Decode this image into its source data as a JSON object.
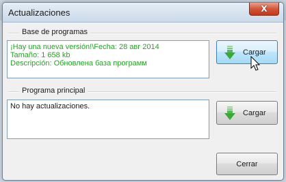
{
  "window": {
    "title": "Actualizaciones",
    "close_glyph": "X"
  },
  "base_group": {
    "label": "Base de programas",
    "lines": [
      "¡Hay una nueva versión!\\Fecha: 28 авг 2014",
      "Tamaño: 1 658 kb",
      "Descripción: Обновлена база программ"
    ],
    "button_label": "Cargar"
  },
  "main_group": {
    "label": "Programa principal",
    "lines": [
      "No hay actualizaciones."
    ],
    "button_label": "Cargar"
  },
  "close_button_label": "Cerrar",
  "icons": {
    "download": "download-arrow-icon",
    "close": "close-icon",
    "cursor": "mouse-pointer-icon"
  },
  "colors": {
    "green_text": "#2aa02a",
    "close_red": "#c03a1d",
    "arrow_green": "#3aa83a"
  }
}
